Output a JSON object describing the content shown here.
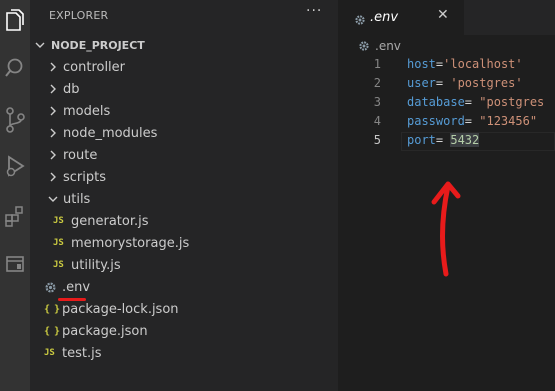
{
  "sidebar": {
    "header": "EXPLORER",
    "more_label": "···",
    "project": "NODE_PROJECT",
    "tree": [
      {
        "label": "controller",
        "kind": "folder"
      },
      {
        "label": "db",
        "kind": "folder"
      },
      {
        "label": "models",
        "kind": "folder"
      },
      {
        "label": "node_modules",
        "kind": "folder"
      },
      {
        "label": "route",
        "kind": "folder"
      },
      {
        "label": "scripts",
        "kind": "folder"
      },
      {
        "label": "utils",
        "kind": "folder-open"
      },
      {
        "label": "generator.js",
        "kind": "js",
        "badge": "JS"
      },
      {
        "label": "memorystorage.js",
        "kind": "js",
        "badge": "JS"
      },
      {
        "label": "utility.js",
        "kind": "js",
        "badge": "JS"
      },
      {
        "label": ".env",
        "kind": "env"
      },
      {
        "label": "package-lock.json",
        "kind": "json",
        "badge": "{ }"
      },
      {
        "label": "package.json",
        "kind": "json",
        "badge": "{ }"
      },
      {
        "label": "test.js",
        "kind": "js",
        "badge": "JS"
      }
    ]
  },
  "editor": {
    "tab_label": ".env",
    "tab_close": "✕",
    "breadcrumb": ".env",
    "lines": [
      {
        "num": "1",
        "key": "host",
        "sep": "=",
        "value": "'localhost'"
      },
      {
        "num": "2",
        "key": "user",
        "sep": "= ",
        "value": "'postgres'"
      },
      {
        "num": "3",
        "key": "database",
        "sep": "= ",
        "value": "\"postgres"
      },
      {
        "num": "4",
        "key": "password",
        "sep": "= ",
        "value": "\"123456\""
      },
      {
        "num": "5",
        "key": "port",
        "sep": "= ",
        "value": "5432"
      }
    ]
  },
  "colors": {
    "annotation": "#e81b1b",
    "key": "#569cd6",
    "string": "#ce9178",
    "number": "#b5cea8",
    "js_badge": "#cbcb41"
  }
}
